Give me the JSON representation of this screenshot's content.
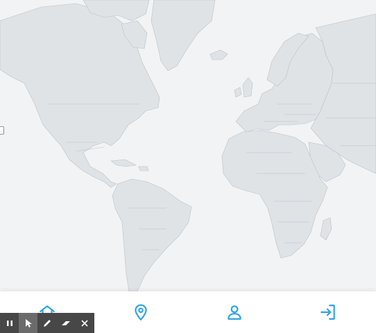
{
  "theme": {
    "accent": "#2aa4e6",
    "ocean": "#f2f3f4",
    "land": "#dfe3e6"
  },
  "map": {
    "type": "world-map",
    "labels": "none"
  },
  "bottom_nav": {
    "items": [
      {
        "id": "home",
        "icon": "home-icon",
        "label": ""
      },
      {
        "id": "location",
        "icon": "map-pin-icon",
        "label": ""
      },
      {
        "id": "profile",
        "icon": "user-icon",
        "label": ""
      },
      {
        "id": "login",
        "icon": "sign-in-icon",
        "label": ""
      }
    ]
  },
  "annotation_toolbar": {
    "tools": [
      "pause-icon",
      "cursor-icon",
      "pen-icon",
      "eraser-icon",
      "close-icon"
    ],
    "active_tool": "cursor-icon"
  }
}
